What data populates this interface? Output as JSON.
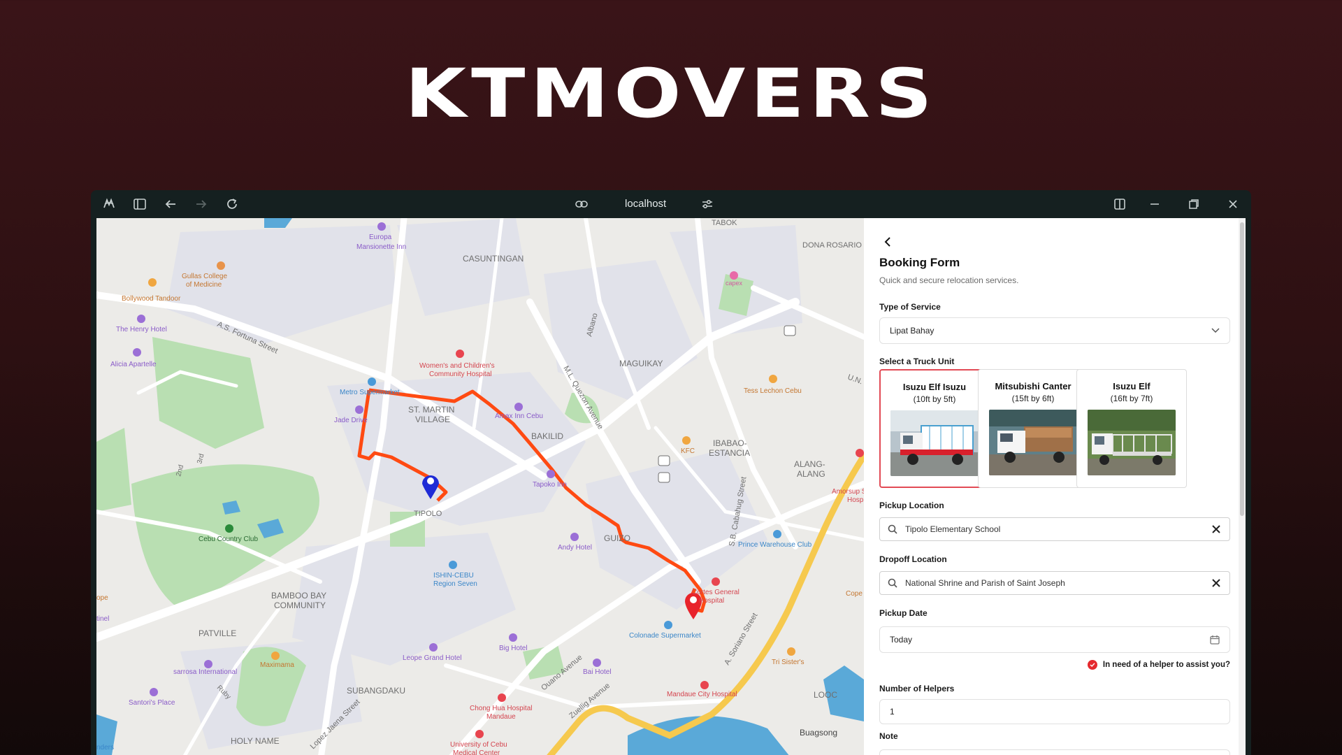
{
  "hero": {
    "title": "KTMOVERS"
  },
  "browser": {
    "url": "localhost"
  },
  "map": {
    "labels": [
      "TABOK",
      "DONA ROSARIO VILLAGE",
      "CASUNTINGAN",
      "Europa",
      "Mansionette Inn",
      "Gullas College",
      "of Medicine",
      "Bollywood Tandoor",
      "The Henry Hotel",
      "A.S. Fortuna Street",
      "Alicia Apartelle",
      "Women's and Children's",
      "Community Hospital",
      "Albano",
      "MAGUIKAY",
      "M.L. Quezon Avenue",
      "capex",
      "Metro Supermarket",
      "ST. MARTIN",
      "VILLAGE",
      "Amax Inn Cebu",
      "Jade Drive",
      "BAKILID",
      "Tess Lechon Cebu",
      "IBABAO-",
      "ESTANCIA",
      "KFC",
      "ALANG-",
      "ALANG",
      "Tapoko Inn",
      "2nd",
      "3rd",
      "Cebu Country Club",
      "TIPOLO",
      "S.B. Cabahug Street",
      "Andy Hotel",
      "GUIZO",
      "Prince Warehouse Club",
      "ISHIN-CEBU",
      "Region Seven",
      "Cortes General",
      "Hospital",
      "BAMBOO BAY",
      "COMMUNITY",
      "PATVILLE",
      "Colonade Supermarket",
      "Big Hotel",
      "Leope Grand Hotel",
      "A. Soriano Street",
      "Maximama",
      "sarrosa International",
      "Bai Hotel",
      "Ouano Avenue",
      "Tri Sister's",
      "Ruby",
      "Santori's Place",
      "SUBANGDAKU",
      "Mandaue City Hospital",
      "Chong Hua Hospital",
      "Mandaue",
      "Zuellig Avenue",
      "Lopez Jaena Street",
      "HOLY NAME",
      "University of Cebu",
      "Medical Center",
      "LOOC",
      "Buagsong",
      "Amorsup S",
      "Hosp",
      "Cope",
      "U.N.",
      "ope",
      "tinel",
      "nders"
    ]
  },
  "form": {
    "title": "Booking Form",
    "subtitle": "Quick and secure relocation services.",
    "service_label": "Type of Service",
    "service_value": "Lipat Bahay",
    "truck_label": "Select a Truck Unit",
    "trucks": [
      {
        "name": "Isuzu Elf Isuzu",
        "dim": "(10ft by 5ft)"
      },
      {
        "name": "Mitsubishi Canter",
        "dim": "(15ft by 6ft)"
      },
      {
        "name": "Isuzu Elf",
        "dim": "(16ft by 7ft)"
      }
    ],
    "pickup_label": "Pickup Location",
    "pickup_value": "Tipolo Elementary School",
    "dropoff_label": "Dropoff Location",
    "dropoff_value": "National Shrine and Parish of Saint Joseph",
    "date_label": "Pickup Date",
    "date_value": "Today",
    "helper_label": "In need of a helper to assist you?",
    "helpers_label": "Number of Helpers",
    "helpers_value": "1",
    "note_label": "Note"
  },
  "colors": {
    "route": "#ff4a12",
    "selected_border": "#e24a55",
    "pin_pickup": "#1f2bd6",
    "pin_dropoff": "#e8232b",
    "helper_check": "#e5292e"
  }
}
